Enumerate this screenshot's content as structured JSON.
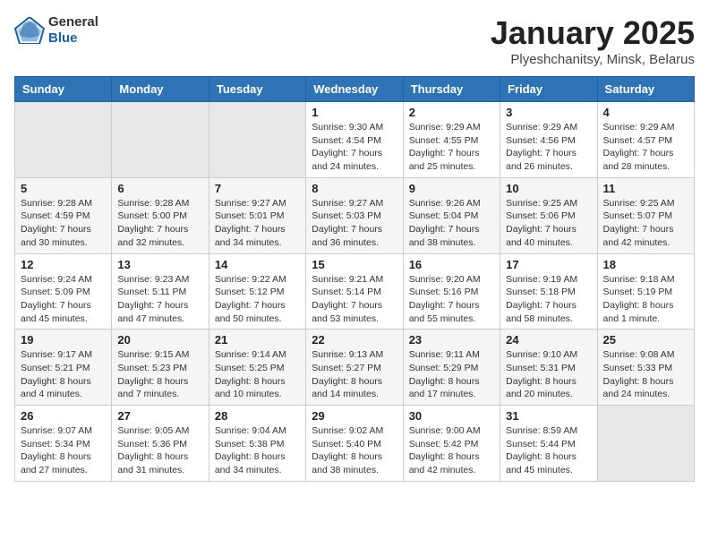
{
  "header": {
    "logo_general": "General",
    "logo_blue": "Blue",
    "month_title": "January 2025",
    "location": "Plyeshchanitsy, Minsk, Belarus"
  },
  "days_of_week": [
    "Sunday",
    "Monday",
    "Tuesday",
    "Wednesday",
    "Thursday",
    "Friday",
    "Saturday"
  ],
  "weeks": [
    [
      {
        "day": "",
        "info": ""
      },
      {
        "day": "",
        "info": ""
      },
      {
        "day": "",
        "info": ""
      },
      {
        "day": "1",
        "info": "Sunrise: 9:30 AM\nSunset: 4:54 PM\nDaylight: 7 hours\nand 24 minutes."
      },
      {
        "day": "2",
        "info": "Sunrise: 9:29 AM\nSunset: 4:55 PM\nDaylight: 7 hours\nand 25 minutes."
      },
      {
        "day": "3",
        "info": "Sunrise: 9:29 AM\nSunset: 4:56 PM\nDaylight: 7 hours\nand 26 minutes."
      },
      {
        "day": "4",
        "info": "Sunrise: 9:29 AM\nSunset: 4:57 PM\nDaylight: 7 hours\nand 28 minutes."
      }
    ],
    [
      {
        "day": "5",
        "info": "Sunrise: 9:28 AM\nSunset: 4:59 PM\nDaylight: 7 hours\nand 30 minutes."
      },
      {
        "day": "6",
        "info": "Sunrise: 9:28 AM\nSunset: 5:00 PM\nDaylight: 7 hours\nand 32 minutes."
      },
      {
        "day": "7",
        "info": "Sunrise: 9:27 AM\nSunset: 5:01 PM\nDaylight: 7 hours\nand 34 minutes."
      },
      {
        "day": "8",
        "info": "Sunrise: 9:27 AM\nSunset: 5:03 PM\nDaylight: 7 hours\nand 36 minutes."
      },
      {
        "day": "9",
        "info": "Sunrise: 9:26 AM\nSunset: 5:04 PM\nDaylight: 7 hours\nand 38 minutes."
      },
      {
        "day": "10",
        "info": "Sunrise: 9:25 AM\nSunset: 5:06 PM\nDaylight: 7 hours\nand 40 minutes."
      },
      {
        "day": "11",
        "info": "Sunrise: 9:25 AM\nSunset: 5:07 PM\nDaylight: 7 hours\nand 42 minutes."
      }
    ],
    [
      {
        "day": "12",
        "info": "Sunrise: 9:24 AM\nSunset: 5:09 PM\nDaylight: 7 hours\nand 45 minutes."
      },
      {
        "day": "13",
        "info": "Sunrise: 9:23 AM\nSunset: 5:11 PM\nDaylight: 7 hours\nand 47 minutes."
      },
      {
        "day": "14",
        "info": "Sunrise: 9:22 AM\nSunset: 5:12 PM\nDaylight: 7 hours\nand 50 minutes."
      },
      {
        "day": "15",
        "info": "Sunrise: 9:21 AM\nSunset: 5:14 PM\nDaylight: 7 hours\nand 53 minutes."
      },
      {
        "day": "16",
        "info": "Sunrise: 9:20 AM\nSunset: 5:16 PM\nDaylight: 7 hours\nand 55 minutes."
      },
      {
        "day": "17",
        "info": "Sunrise: 9:19 AM\nSunset: 5:18 PM\nDaylight: 7 hours\nand 58 minutes."
      },
      {
        "day": "18",
        "info": "Sunrise: 9:18 AM\nSunset: 5:19 PM\nDaylight: 8 hours\nand 1 minute."
      }
    ],
    [
      {
        "day": "19",
        "info": "Sunrise: 9:17 AM\nSunset: 5:21 PM\nDaylight: 8 hours\nand 4 minutes."
      },
      {
        "day": "20",
        "info": "Sunrise: 9:15 AM\nSunset: 5:23 PM\nDaylight: 8 hours\nand 7 minutes."
      },
      {
        "day": "21",
        "info": "Sunrise: 9:14 AM\nSunset: 5:25 PM\nDaylight: 8 hours\nand 10 minutes."
      },
      {
        "day": "22",
        "info": "Sunrise: 9:13 AM\nSunset: 5:27 PM\nDaylight: 8 hours\nand 14 minutes."
      },
      {
        "day": "23",
        "info": "Sunrise: 9:11 AM\nSunset: 5:29 PM\nDaylight: 8 hours\nand 17 minutes."
      },
      {
        "day": "24",
        "info": "Sunrise: 9:10 AM\nSunset: 5:31 PM\nDaylight: 8 hours\nand 20 minutes."
      },
      {
        "day": "25",
        "info": "Sunrise: 9:08 AM\nSunset: 5:33 PM\nDaylight: 8 hours\nand 24 minutes."
      }
    ],
    [
      {
        "day": "26",
        "info": "Sunrise: 9:07 AM\nSunset: 5:34 PM\nDaylight: 8 hours\nand 27 minutes."
      },
      {
        "day": "27",
        "info": "Sunrise: 9:05 AM\nSunset: 5:36 PM\nDaylight: 8 hours\nand 31 minutes."
      },
      {
        "day": "28",
        "info": "Sunrise: 9:04 AM\nSunset: 5:38 PM\nDaylight: 8 hours\nand 34 minutes."
      },
      {
        "day": "29",
        "info": "Sunrise: 9:02 AM\nSunset: 5:40 PM\nDaylight: 8 hours\nand 38 minutes."
      },
      {
        "day": "30",
        "info": "Sunrise: 9:00 AM\nSunset: 5:42 PM\nDaylight: 8 hours\nand 42 minutes."
      },
      {
        "day": "31",
        "info": "Sunrise: 8:59 AM\nSunset: 5:44 PM\nDaylight: 8 hours\nand 45 minutes."
      },
      {
        "day": "",
        "info": ""
      }
    ]
  ]
}
